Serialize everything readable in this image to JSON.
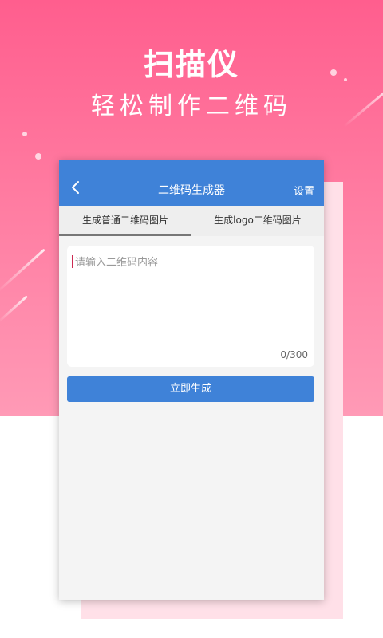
{
  "promo": {
    "title": "扫描仪",
    "subtitle": "轻松制作二维码",
    "background_colors": [
      "#ff5e8e",
      "#ff9ab6"
    ]
  },
  "app": {
    "header": {
      "title": "二维码生成器",
      "back_icon": "chevron-left-icon",
      "settings_label": "设置",
      "color": "#3f82d8"
    },
    "tabs": [
      {
        "label": "生成普通二维码图片",
        "active": true
      },
      {
        "label": "生成logo二维码图片",
        "active": false
      }
    ],
    "input": {
      "placeholder": "请输入二维码内容",
      "value": "",
      "counter": "0/300"
    },
    "generate_button": {
      "label": "立即生成"
    }
  }
}
